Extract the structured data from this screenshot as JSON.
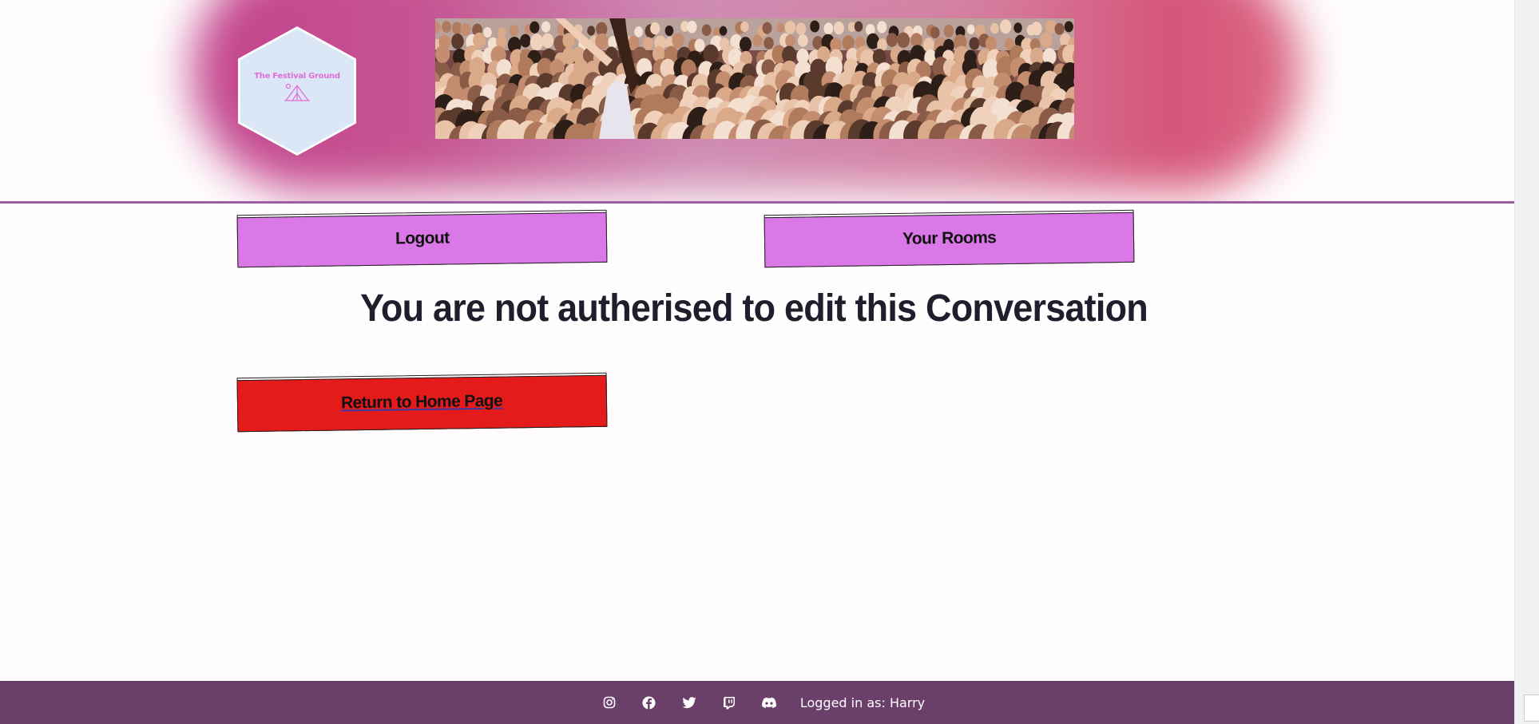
{
  "header": {
    "logo_text": "The Festival Ground",
    "banner_alt": "Festival crowd photo"
  },
  "nav": {
    "logout_label": "Logout",
    "rooms_label": "Your Rooms"
  },
  "main": {
    "heading": "You are not autherised to edit this Conversation",
    "return_label": "Return to Home Page"
  },
  "footer": {
    "icons": [
      "instagram-icon",
      "facebook-icon",
      "twitter-icon",
      "twitch-icon",
      "discord-icon"
    ],
    "logged_in_label": "Logged in as: Harry"
  },
  "colors": {
    "button_purple": "#d978e6",
    "button_red": "#e51b1b",
    "footer_bg": "#6a406a",
    "divider": "#9b5fa3"
  }
}
